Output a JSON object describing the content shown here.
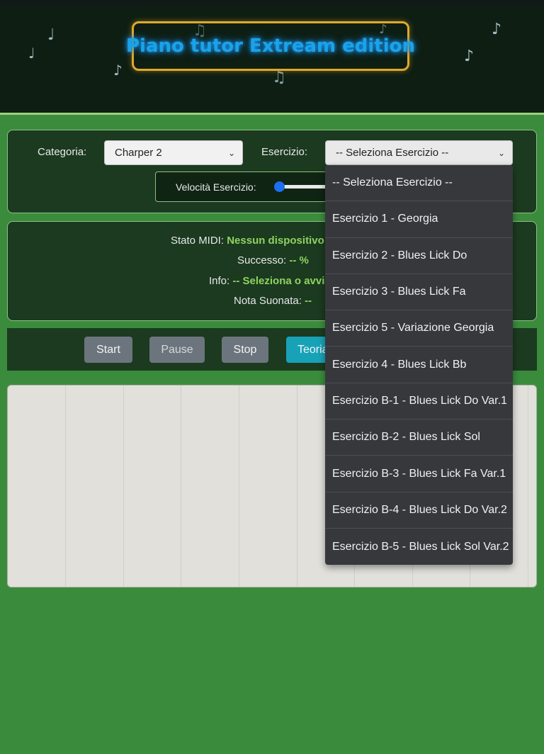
{
  "header": {
    "title": "Piano tutor Extream edition",
    "notes": [
      "♩",
      "♩",
      "♪",
      "♫",
      "♪",
      "♪",
      "♫",
      "♪"
    ]
  },
  "controls": {
    "category_label": "Categoria:",
    "category_value": "Charper 2",
    "exercise_label": "Esercizio:",
    "exercise_value": "-- Seleziona Esercizio --",
    "speed_label": "Velocità Esercizio:",
    "speed_level": 0.0
  },
  "status": {
    "midi_label": "Stato MIDI:",
    "midi_value": "Nessun dispositivo M",
    "success_label": "Successo:",
    "success_value": "-- %",
    "info_label": "Info:",
    "info_value": "-- Seleziona o avvia",
    "note_label": "Nota Suonata:",
    "note_value": "--"
  },
  "buttons": {
    "start": "Start",
    "pause": "Pause",
    "stop": "Stop",
    "theory": "Teoria"
  },
  "dropdown": {
    "options": [
      "-- Seleziona Esercizio --",
      "Esercizio 1 - Georgia",
      "Esercizio 2 - Blues Lick Do",
      "Esercizio 3 - Blues Lick Fa",
      "Esercizio 5 - Variazione Georgia",
      "Esercizio 4 - Blues Lick Bb",
      "Esercizio B-1 - Blues Lick Do Var.1",
      "Esercizio B-2 - Blues Lick Sol",
      "Esercizio B-3 - Blues Lick Fa Var.1",
      "Esercizio B-4 - Blues Lick Do Var.2",
      "Esercizio B-5 - Blues Lick Sol Var.2"
    ]
  },
  "colors": {
    "page_bg": "#3a8c3c",
    "panel_bg": "#1b3a20",
    "title_glow": "#1aa3e8",
    "title_border": "#e0a92b",
    "status_value": "#8fd35f",
    "btn_grey": "#6c757d",
    "btn_teal": "#17a2b8",
    "slider_thumb": "#1e6ff0",
    "dropdown_bg": "#37383c"
  }
}
